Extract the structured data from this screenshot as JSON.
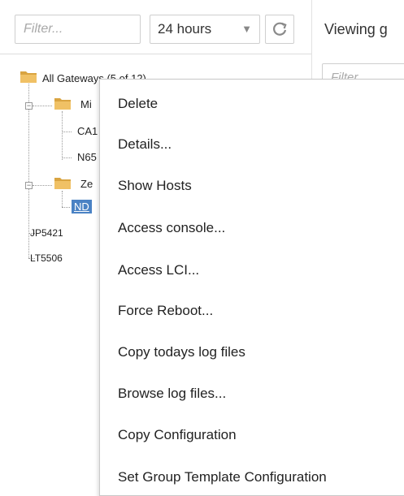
{
  "toolbar": {
    "filter_placeholder": "Filter...",
    "time_range": "24 hours",
    "refresh_icon": "refresh-icon"
  },
  "right_pane": {
    "title": "Viewing g",
    "filter_placeholder": "Filter"
  },
  "tree": {
    "root": {
      "label": "All Gateways (5 of 12)",
      "icon": "folder-icon"
    },
    "groups": [
      {
        "label": "Mi",
        "icon": "folder-icon",
        "children": [
          "CA1",
          "N65"
        ]
      },
      {
        "label": "Ze",
        "icon": "folder-icon",
        "children": [
          "ND"
        ]
      }
    ],
    "top_level_items": [
      "JP5421",
      "LT5506"
    ]
  },
  "context_menu": {
    "items": [
      "Delete",
      "Details...",
      "Show Hosts",
      "Access console...",
      "Access LCI...",
      "Force Reboot...",
      "Copy todays log files",
      "Browse log files...",
      "Copy Configuration",
      "Set Group Template Configuration"
    ]
  },
  "colors": {
    "selection": "#4a82c4",
    "folder_front": "#f0c165",
    "folder_back": "#d9a441",
    "border": "#cfcfcf"
  }
}
